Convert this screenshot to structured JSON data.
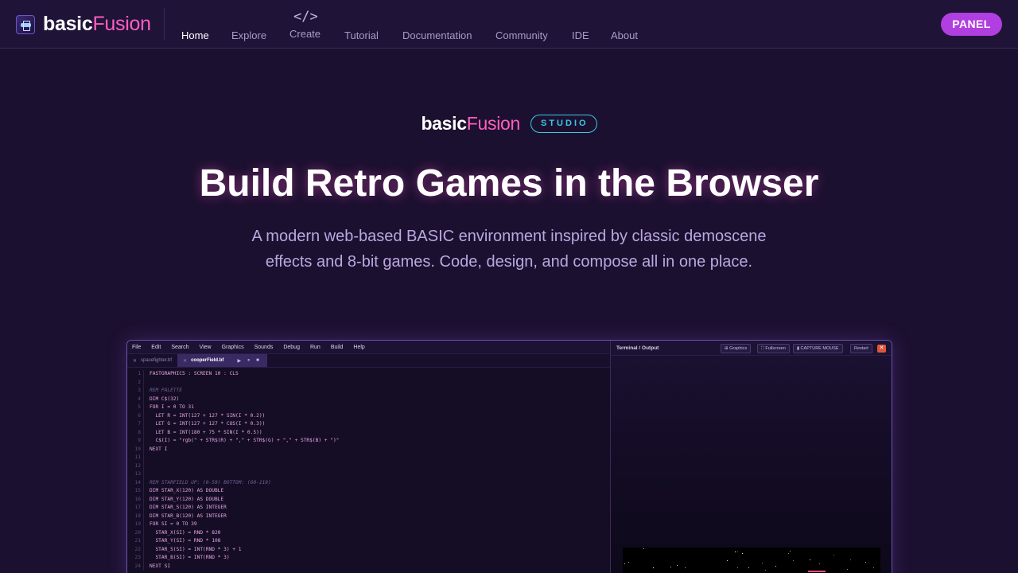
{
  "brand": {
    "basic": "basic",
    "fusion": "Fusion"
  },
  "nav": {
    "items": [
      {
        "label": "Home"
      },
      {
        "label": "Explore"
      },
      {
        "label": "Create",
        "icon": "</>"
      },
      {
        "label": "Tutorial"
      },
      {
        "label": "Documentation"
      },
      {
        "label": "Community"
      },
      {
        "label": "IDE"
      },
      {
        "label": "About"
      }
    ],
    "active": "Home",
    "panel_label": "PANEL"
  },
  "hero": {
    "badge": "STUDIO",
    "title": "Build Retro Games in the Browser",
    "subtitle": "A modern web-based BASIC environment inspired by classic demoscene effects and 8-bit games. Code, design, and compose all in one place."
  },
  "editor": {
    "menu": [
      "File",
      "Edit",
      "Search",
      "View",
      "Graphics",
      "Sounds",
      "Debug",
      "Run",
      "Build",
      "Help"
    ],
    "tabs": [
      {
        "label": "spacefighter.bf",
        "active": false
      },
      {
        "label": "cooperField.bf",
        "active": true
      }
    ],
    "tab_controls": [
      "▶",
      "⏸",
      "■"
    ],
    "lines": [
      {
        "num": "1",
        "text": "FASTGRAPHICS : SCREEN 10 : CLS"
      },
      {
        "num": "2",
        "text": ""
      },
      {
        "num": "3",
        "text": "REM PALETTE",
        "comment": true
      },
      {
        "num": "4",
        "text": "DIM C$(32)"
      },
      {
        "num": "5",
        "text": "FOR I = 0 TO 31"
      },
      {
        "num": "6",
        "text": "  LET R = INT(127 + 127 * SIN(I * 0.2))"
      },
      {
        "num": "7",
        "text": "  LET G = INT(127 + 127 * COS(I * 0.3))"
      },
      {
        "num": "8",
        "text": "  LET B = INT(180 + 75 * SIN(I * 0.5))"
      },
      {
        "num": "9",
        "text": "  C$(I) = \"rgb(\" + STR$(R) + \",\" + STR$(G) + \",\" + STR$(B) + \")\""
      },
      {
        "num": "10",
        "text": "NEXT I"
      },
      {
        "num": "11",
        "text": ""
      },
      {
        "num": "12",
        "text": ""
      },
      {
        "num": "13",
        "text": ""
      },
      {
        "num": "14",
        "text": "REM STARFIELD UP: (0-59) BOTTOM: (60-119)",
        "comment": true
      },
      {
        "num": "15",
        "text": "DIM STAR_X(120) AS DOUBLE"
      },
      {
        "num": "16",
        "text": "DIM STAR_Y(120) AS DOUBLE"
      },
      {
        "num": "17",
        "text": "DIM STAR_S(120) AS INTEGER"
      },
      {
        "num": "18",
        "text": "DIM STAR_B(120) AS INTEGER"
      },
      {
        "num": "19",
        "text": "FOR SI = 0 TO 39"
      },
      {
        "num": "20",
        "text": "  STAR_X(SI) = RND * 820"
      },
      {
        "num": "21",
        "text": "  STAR_Y(SI) = RND * 108"
      },
      {
        "num": "22",
        "text": "  STAR_S(SI) = INT(RND * 3) + 1"
      },
      {
        "num": "23",
        "text": "  STAR_B(SI) = INT(RND * 3)"
      },
      {
        "num": "24",
        "text": "NEXT SI"
      }
    ]
  },
  "terminal": {
    "title": "Terminal / Output",
    "buttons": [
      "⊞ Graphics",
      "⛶ Fullscreen",
      "▮ CAPTURE MOUSE",
      "Restart"
    ],
    "close": "✕"
  }
}
